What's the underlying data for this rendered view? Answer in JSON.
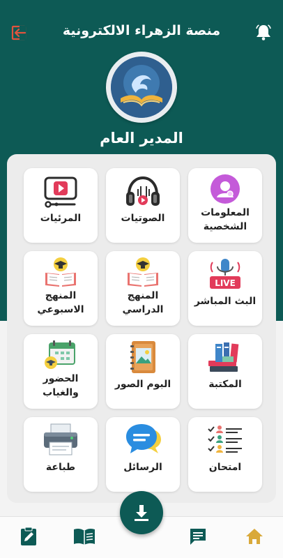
{
  "header": {
    "title": "منصة الزهراء الالكترونية",
    "bell_icon": "bell-icon",
    "logout_icon": "logout-icon"
  },
  "profile": {
    "role": "المدير العام"
  },
  "colors": {
    "primary": "#0d5a55",
    "accent": "#d9a93a",
    "logout": "#e2533d"
  },
  "tiles": [
    {
      "label": "المعلومات الشخصية",
      "icon": "user-profile-icon"
    },
    {
      "label": "الصوتيات",
      "icon": "headphones-icon"
    },
    {
      "label": "المرئيات",
      "icon": "video-player-icon"
    },
    {
      "label": "البث المباشر",
      "icon": "live-mic-icon"
    },
    {
      "label": "المنهج الدراسي",
      "icon": "curriculum-book-icon"
    },
    {
      "label": "المنهج الاسبوعي",
      "icon": "weekly-book-icon"
    },
    {
      "label": "المكتبة",
      "icon": "library-books-icon"
    },
    {
      "label": "البوم الصور",
      "icon": "photo-album-icon"
    },
    {
      "label": "الحضور والغياب",
      "icon": "attendance-calendar-icon"
    },
    {
      "label": "امتحان",
      "icon": "exam-checklist-icon"
    },
    {
      "label": "الرسائل",
      "icon": "messages-icon"
    },
    {
      "label": "طباعة",
      "icon": "printer-icon"
    }
  ],
  "bottom_nav": [
    {
      "name": "home",
      "icon": "home-icon"
    },
    {
      "name": "chat",
      "icon": "chat-icon"
    },
    {
      "name": "book",
      "icon": "book-icon"
    },
    {
      "name": "edit",
      "icon": "clipboard-edit-icon"
    }
  ],
  "fab": {
    "icon": "download-icon"
  }
}
